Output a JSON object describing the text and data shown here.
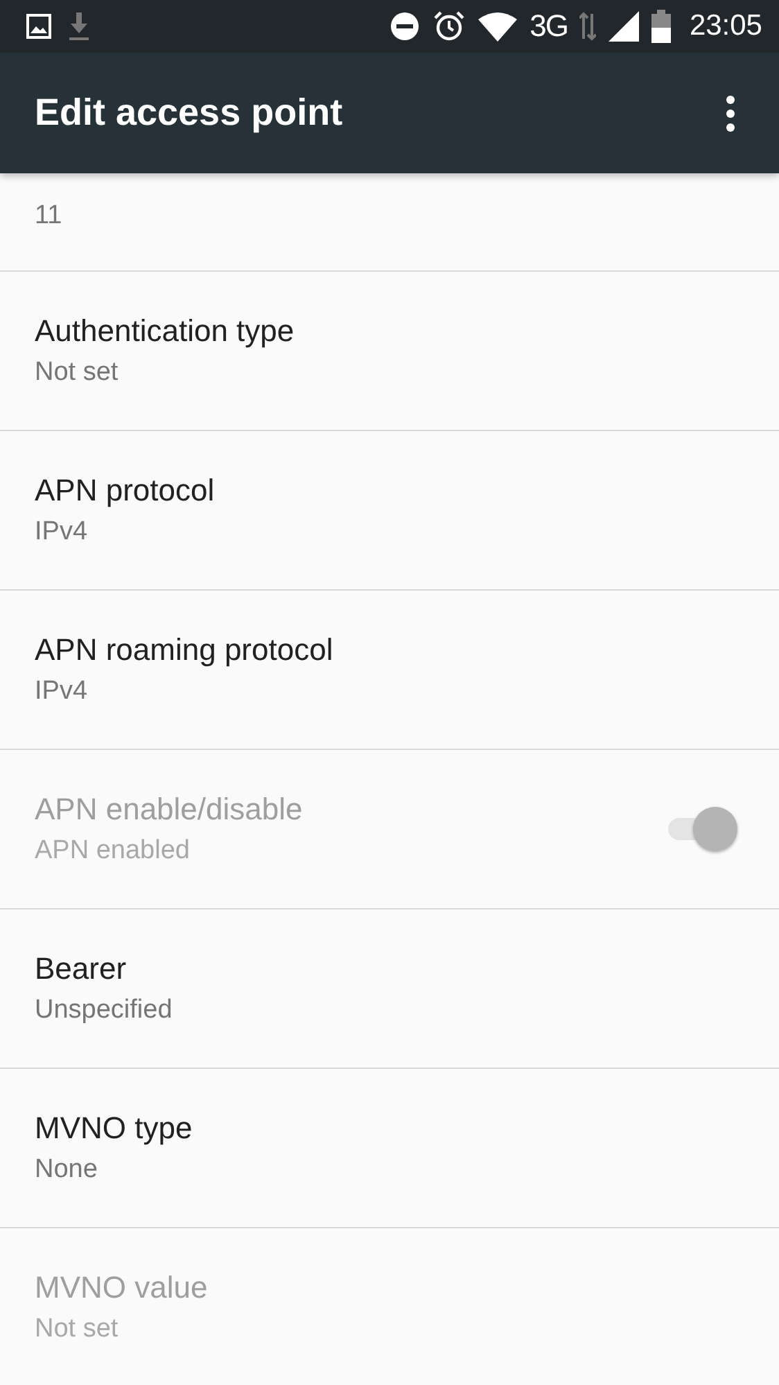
{
  "status_bar": {
    "network": "3G",
    "time": "23:05"
  },
  "app_bar": {
    "title": "Edit access point"
  },
  "items": [
    {
      "kind": "text",
      "summary": "11",
      "disabled": false
    },
    {
      "kind": "text",
      "title": "Authentication type",
      "summary": "Not set",
      "disabled": false
    },
    {
      "kind": "text",
      "title": "APN protocol",
      "summary": "IPv4",
      "disabled": false
    },
    {
      "kind": "text",
      "title": "APN roaming protocol",
      "summary": "IPv4",
      "disabled": false
    },
    {
      "kind": "switch",
      "title": "APN enable/disable",
      "summary": "APN enabled",
      "disabled": true,
      "checked": true
    },
    {
      "kind": "text",
      "title": "Bearer",
      "summary": "Unspecified",
      "disabled": false
    },
    {
      "kind": "text",
      "title": "MVNO type",
      "summary": "None",
      "disabled": false
    },
    {
      "kind": "text",
      "title": "MVNO value",
      "summary": "Not set",
      "disabled": true
    }
  ]
}
